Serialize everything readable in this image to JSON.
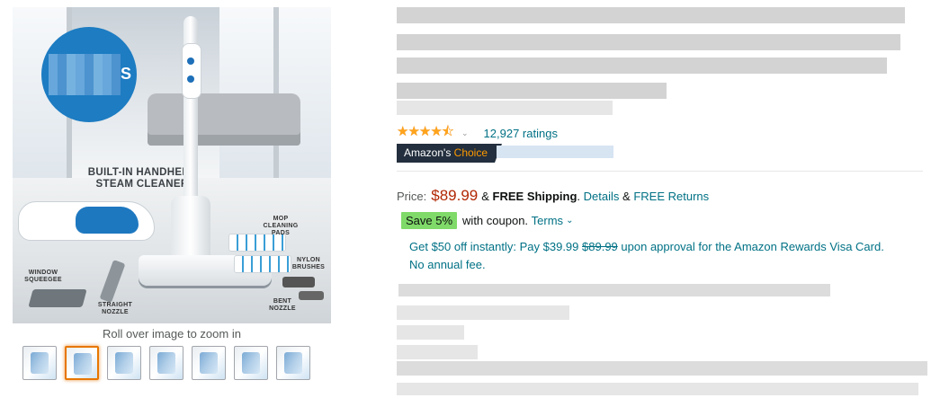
{
  "gallery": {
    "image_alt": "Steam mop product image",
    "built_in_label": "BUILT-IN HANDHELD STEAM CLEANER",
    "labels": {
      "mop_pads": "MOP CLEANING PADS",
      "nylon_brushes": "NYLON BRUSHES",
      "window_squeegee": "WINDOW SQUEEGEE",
      "straight_nozzle": "STRAIGHT NOZZLE",
      "bent_nozzle": "BENT NOZZLE"
    },
    "circle_suffix": "S",
    "zoom_hint": "Roll over image to zoom in",
    "thumbnails": [
      "thumb-1",
      "thumb-2",
      "thumb-3",
      "thumb-4",
      "thumb-5",
      "thumb-6",
      "thumb-7",
      "thumb-8"
    ],
    "selected_thumbnail": 1
  },
  "rating": {
    "stars": "★★★★⯪",
    "count_text": "12,927 ratings",
    "chevron": "⌄"
  },
  "badge": {
    "prefix": "Amazon's",
    "highlight": "Choice"
  },
  "price_block": {
    "label": "Price:",
    "price": "$89.99",
    "amp": "&",
    "shipping": "FREE Shipping",
    "details": "Details",
    "returns": "FREE Returns"
  },
  "coupon": {
    "badge": "Save 5%",
    "text": "with coupon.",
    "terms": "Terms"
  },
  "offer": {
    "line1_before": "Get $50 off instantly: Pay $39.99",
    "old_price": "$89.99",
    "line1_after": "upon approval for the Amazon Rewards Visa Card.",
    "line2": "No annual fee."
  },
  "colors": {
    "link": "#007185",
    "price": "#B12704",
    "star": "#FFA41C",
    "badge_bg": "#232F3E",
    "badge_accent": "#FF9900",
    "coupon_green": "#7FDA69"
  }
}
